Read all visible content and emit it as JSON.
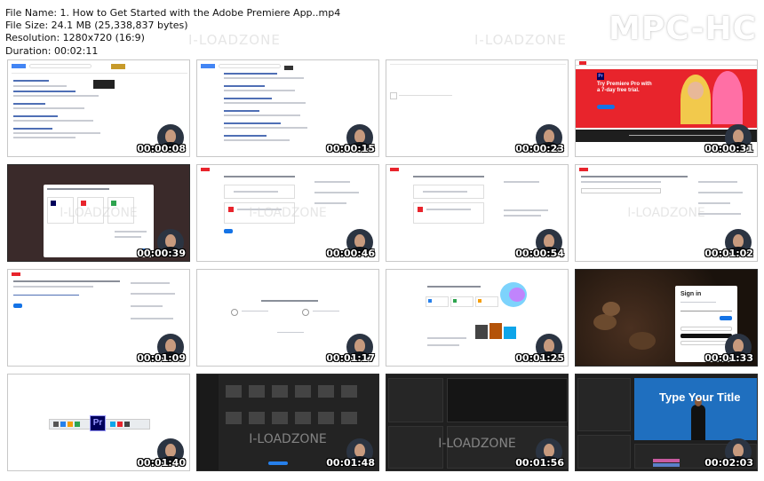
{
  "file_info": {
    "name": "File Name: 1. How to Get Started with the Adobe Premiere App..mp4",
    "size": "File Size: 24.1 MB (25,338,837 bytes)",
    "resolution": "Resolution: 1280x720 (16:9)",
    "duration": "Duration: 00:02:11"
  },
  "brand": "MPC-HC",
  "watermark": "I-LOADZONE",
  "thumbnails": [
    {
      "time": "00:00:08",
      "scene": "Google search results page",
      "theme": "light"
    },
    {
      "time": "00:00:15",
      "scene": "Google search results page",
      "theme": "light"
    },
    {
      "time": "00:00:23",
      "scene": "Blank loading page",
      "theme": "light"
    },
    {
      "time": "00:00:31",
      "scene": "Adobe Premiere Pro free trial page",
      "theme": "light",
      "headline": "Try Premiere Pro with a 7-day free trial."
    },
    {
      "time": "00:00:39",
      "scene": "Plan selection dialog",
      "theme": "dark"
    },
    {
      "time": "00:00:46",
      "scene": "Checkout page",
      "theme": "light"
    },
    {
      "time": "00:00:54",
      "scene": "Checkout page",
      "theme": "light"
    },
    {
      "time": "00:01:02",
      "scene": "Checkout form",
      "theme": "light"
    },
    {
      "time": "00:01:09",
      "scene": "Checkout form",
      "theme": "light"
    },
    {
      "time": "00:01:17",
      "scene": "How to install Creative Cloud",
      "theme": "light"
    },
    {
      "time": "00:01:25",
      "scene": "Welcome to Creative Cloud",
      "theme": "light"
    },
    {
      "time": "00:01:33",
      "scene": "Adobe sign in dialog",
      "theme": "dark",
      "heading": "Sign in"
    },
    {
      "time": "00:01:40",
      "scene": "Taskbar with Premiere icon",
      "theme": "light",
      "app_icon": "Pr"
    },
    {
      "time": "00:01:48",
      "scene": "Premiere home screen",
      "theme": "dark"
    },
    {
      "time": "00:01:56",
      "scene": "Premiere editing workspace",
      "theme": "dark"
    },
    {
      "time": "00:02:03",
      "scene": "Premiere title template",
      "theme": "dark",
      "overlay_text": "Type Your Title"
    }
  ],
  "colors": {
    "adobe_red": "#e8242c",
    "link_blue": "#1a0dab",
    "premiere_purple": "#9999ff",
    "premiere_dark": "#00005b"
  }
}
